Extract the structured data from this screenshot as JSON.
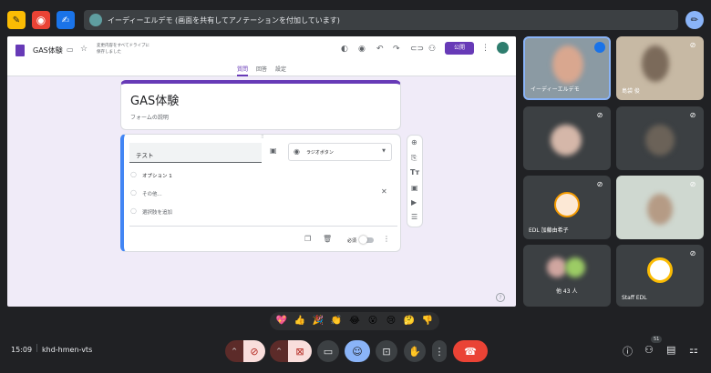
{
  "banner": {
    "text": "イーディーエルデモ (画面を共有してアノテーションを付加しています)"
  },
  "form": {
    "doc_title": "GAS体験",
    "autosave_text_1": "変更内容をすべてドライブに",
    "autosave_text_2": "保存しました",
    "publish_label": "公開",
    "tabs": [
      "質問",
      "回答",
      "設定"
    ],
    "title": "GAS体験",
    "description": "フォームの説明",
    "question_title": "テスト",
    "question_type": "ラジオボタン",
    "options": [
      "オプション 1",
      "その他...",
      "選択肢を追加"
    ],
    "required_label": "必須",
    "help": "?"
  },
  "participants": {
    "tile1_name": "イーディーエルデモ",
    "tile2_name": "島袋 俊",
    "tile5_name": "EDL 加藤由希子",
    "tile7_name": "他 43 人",
    "tile8_name": "Staff EDL"
  },
  "reactions": [
    "💖",
    "👍",
    "🎉",
    "👏",
    "😂",
    "😮",
    "😢",
    "🤔",
    "👎"
  ],
  "bottom": {
    "time": "15:09",
    "meeting_code": "khd-hmen-vts",
    "people_count": "51"
  },
  "colors": {
    "accent_purple": "#673ab7",
    "end_call_red": "#ea4335",
    "meet_blue": "#8ab4f8"
  }
}
